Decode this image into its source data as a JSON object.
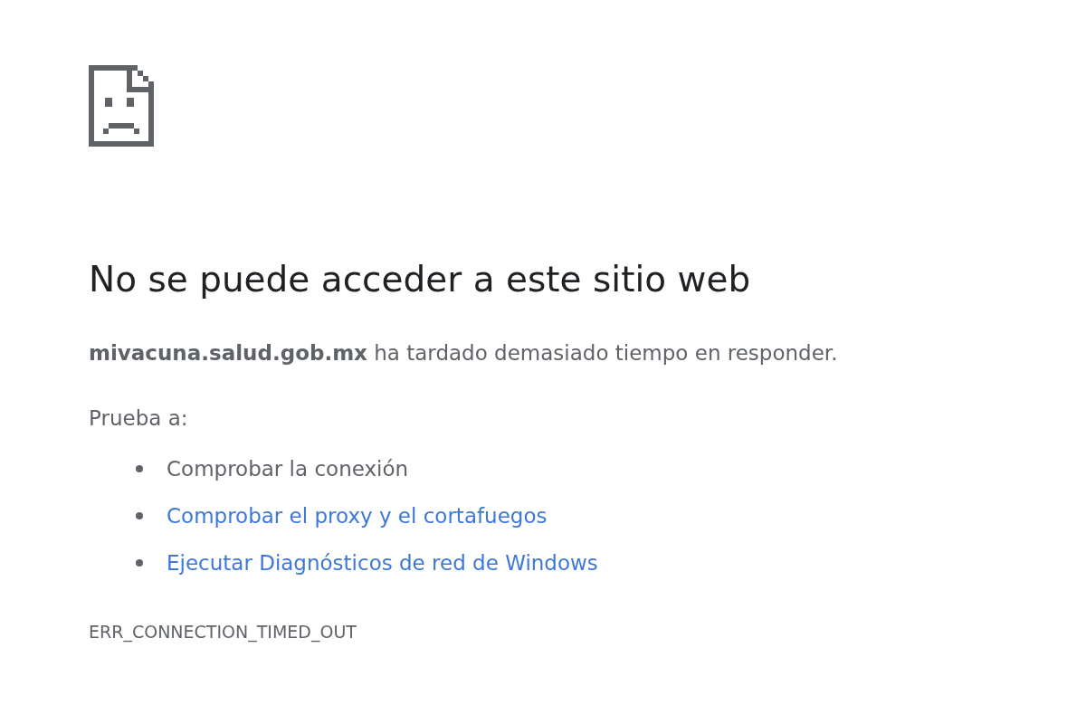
{
  "heading": "No se puede acceder a este sitio web",
  "summary": "**mivacuna.salud.gob.mx** ha tardado demasiado tiempo en responder.",
  "suggestions_label": "Prueba a:",
  "suggestions": [
    {
      "kind": "text",
      "label": "Comprobar la conexión"
    },
    {
      "kind": "link",
      "label": "Comprobar el proxy y el cortafuegos"
    },
    {
      "kind": "link",
      "label": "Ejecutar Diagnósticos de red de Windows"
    }
  ],
  "error_code": "ERR_CONNECTION_TIMED_OUT"
}
